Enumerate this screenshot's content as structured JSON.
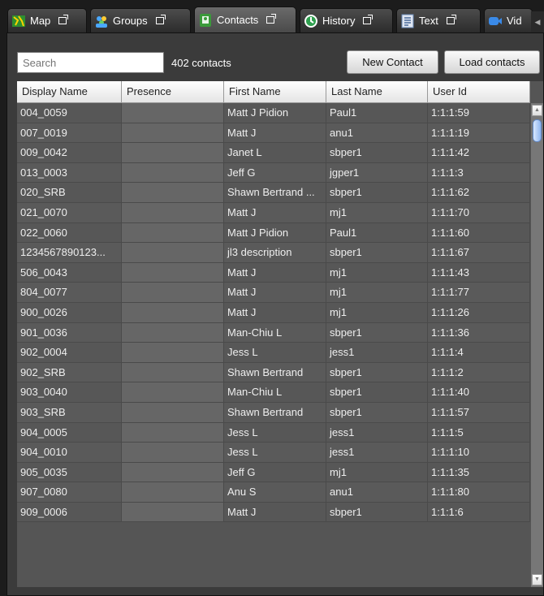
{
  "tabs": [
    {
      "label": "Map",
      "icon": "map-icon"
    },
    {
      "label": "Groups",
      "icon": "groups-icon"
    },
    {
      "label": "Contacts",
      "icon": "contacts-icon"
    },
    {
      "label": "History",
      "icon": "history-icon"
    },
    {
      "label": "Text",
      "icon": "text-icon"
    },
    {
      "label": "Vid",
      "icon": "video-icon"
    }
  ],
  "active_tab": "Contacts",
  "toolbar": {
    "search_placeholder": "Search",
    "count_label": "402 contacts",
    "new_contact_label": "New Contact",
    "load_contacts_label": "Load contacts"
  },
  "table": {
    "columns": [
      "Display Name",
      "Presence",
      "First Name",
      "Last Name",
      "User Id"
    ],
    "rows": [
      [
        "004_0059",
        "",
        "Matt J Pidion",
        "Paul1",
        "1:1:1:59"
      ],
      [
        "007_0019",
        "",
        "Matt J",
        "anu1",
        "1:1:1:19"
      ],
      [
        "009_0042",
        "",
        "Janet L",
        "sbper1",
        "1:1:1:42"
      ],
      [
        "013_0003",
        "",
        "Jeff G",
        "jgper1",
        "1:1:1:3"
      ],
      [
        "020_SRB",
        "",
        "Shawn Bertrand ...",
        "sbper1",
        "1:1:1:62"
      ],
      [
        "021_0070",
        "",
        "Matt J",
        "mj1",
        "1:1:1:70"
      ],
      [
        "022_0060",
        "",
        "Matt J Pidion",
        "Paul1",
        "1:1:1:60"
      ],
      [
        "1234567890123...",
        "",
        "jl3 description",
        "sbper1",
        "1:1:1:67"
      ],
      [
        "506_0043",
        "",
        "Matt J",
        "mj1",
        "1:1:1:43"
      ],
      [
        "804_0077",
        "",
        "Matt J",
        "mj1",
        "1:1:1:77"
      ],
      [
        "900_0026",
        "",
        "Matt J",
        "mj1",
        "1:1:1:26"
      ],
      [
        "901_0036",
        "",
        "Man-Chiu L",
        "sbper1",
        "1:1:1:36"
      ],
      [
        "902_0004",
        "",
        "Jess L",
        "jess1",
        "1:1:1:4"
      ],
      [
        "902_SRB",
        "",
        "Shawn Bertrand",
        "sbper1",
        "1:1:1:2"
      ],
      [
        "903_0040",
        "",
        "Man-Chiu L",
        "sbper1",
        "1:1:1:40"
      ],
      [
        "903_SRB",
        "",
        "Shawn Bertrand",
        "sbper1",
        "1:1:1:57"
      ],
      [
        "904_0005",
        "",
        "Jess L",
        "jess1",
        "1:1:1:5"
      ],
      [
        "904_0010",
        "",
        "Jess L",
        "jess1",
        "1:1:1:10"
      ],
      [
        "905_0035",
        "",
        "Jeff G",
        "mj1",
        "1:1:1:35"
      ],
      [
        "907_0080",
        "",
        "Anu S",
        "anu1",
        "1:1:1:80"
      ],
      [
        "909_0006",
        "",
        "Matt J",
        "sbper1",
        "1:1:1:6"
      ]
    ]
  },
  "colors": {
    "background": "#1c1c1c",
    "panel": "#3b3b3b",
    "row": "#575757",
    "header": "#ffffff",
    "scroll_thumb": "#8fb6f0"
  }
}
